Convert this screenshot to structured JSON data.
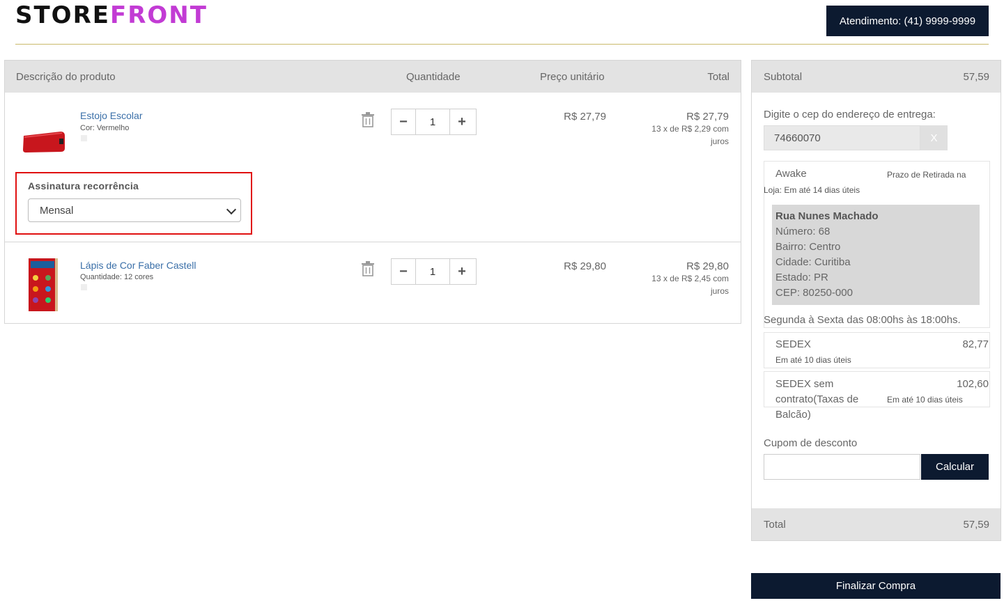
{
  "header": {
    "logo_part1": "STORE",
    "logo_part2": "FRONT",
    "support_label": "Atendimento: (41) 9999-9999"
  },
  "cart": {
    "columns": [
      "Descrição do produto",
      "Quantidade",
      "Preço unitário",
      "Total"
    ],
    "items": [
      {
        "name": "Estojo Escolar",
        "attribute": "Cor: Vermelho",
        "quantity": "1",
        "unit_price": "R$ 27,79",
        "total": "R$ 27,79",
        "installments_line1": "13 x de R$ 2,29 com",
        "installments_line2": "juros"
      },
      {
        "name": "Lápis de Cor Faber Castell",
        "attribute": "Quantidade: 12 cores",
        "quantity": "1",
        "unit_price": "R$ 29,80",
        "total": "R$ 29,80",
        "installments_line1": "13 x de R$ 2,45 com",
        "installments_line2": "juros"
      }
    ],
    "recurrence": {
      "label": "Assinatura recorrência",
      "selected": "Mensal"
    }
  },
  "summary": {
    "subtotal_label": "Subtotal",
    "subtotal_value": "57,59",
    "cep_label": "Digite o cep do endereço de entrega:",
    "cep_value": "74660070",
    "cep_clear": "X",
    "pickup": {
      "name": "Awake",
      "deadline_a": "Prazo de Retirada na",
      "deadline_b": "Loja: Em até 14 dias úteis",
      "street": "Rua Nunes Machado",
      "number": "Número: 68",
      "district": "Bairro: Centro",
      "city": "Cidade: Curitiba",
      "state": "Estado: PR",
      "zip": "CEP: 80250-000",
      "hours": "Segunda à Sexta das 08:00hs às 18:00hs."
    },
    "shipping": [
      {
        "name": "SEDEX",
        "price": "82,77",
        "eta": "Em até 10 dias úteis"
      },
      {
        "name_l1": "SEDEX sem",
        "name_l2": "contrato(Taxas de",
        "name_l3": "Balcão)",
        "price": "102,60",
        "eta": "Em até 10 dias úteis"
      }
    ],
    "coupon_label": "Cupom de desconto",
    "calculate_label": "Calcular",
    "total_label": "Total",
    "total_value": "57,59"
  },
  "finalize_label": "Finalizar Compra"
}
